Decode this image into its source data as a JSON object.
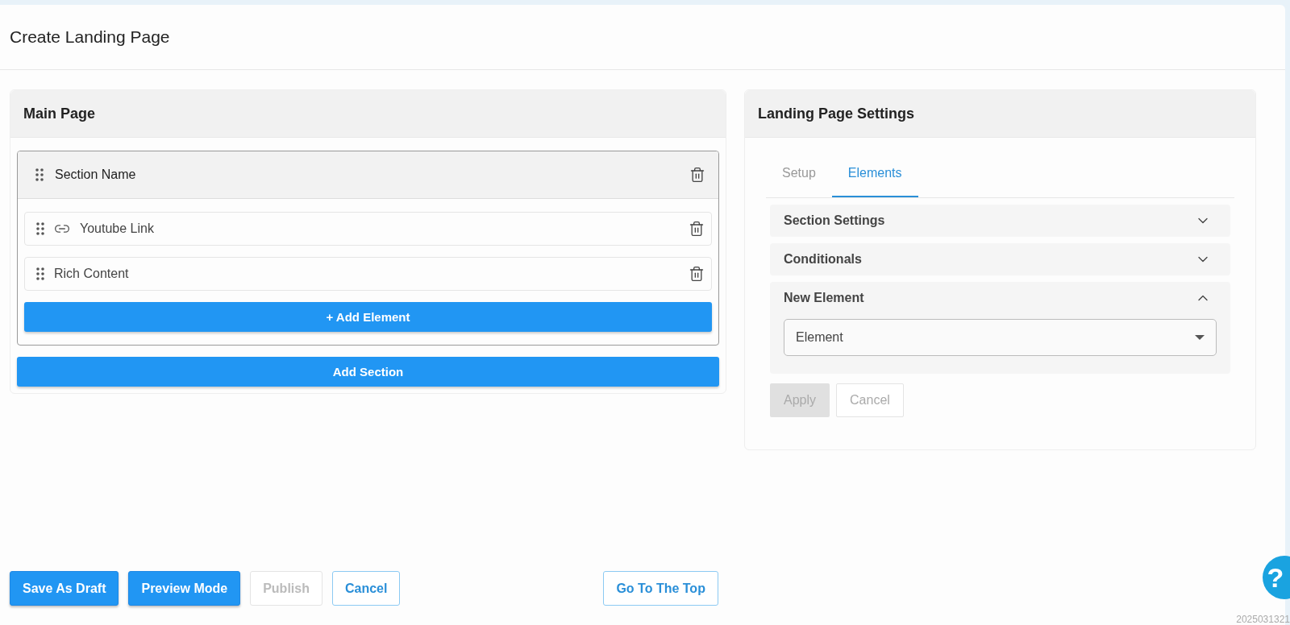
{
  "page": {
    "title": "Create Landing Page"
  },
  "main_panel": {
    "title": "Main Page",
    "section": {
      "name": "Section Name",
      "elements": [
        {
          "label": "Youtube Link",
          "kind": "link"
        },
        {
          "label": "Rich Content",
          "kind": "plain"
        }
      ],
      "add_element_button": "+ Add Element"
    },
    "add_section_button": "Add Section"
  },
  "settings_panel": {
    "title": "Landing Page Settings",
    "tabs": [
      {
        "label": "Setup",
        "selected": false
      },
      {
        "label": "Elements",
        "selected": true
      }
    ],
    "accordions": [
      {
        "title": "Section Settings",
        "expanded": false
      },
      {
        "title": "Conditionals",
        "expanded": false
      },
      {
        "title": "New Element",
        "expanded": true,
        "select_value": "Element"
      }
    ],
    "buttons": [
      {
        "label": "Apply",
        "disabled": true,
        "kind": "filled"
      },
      {
        "label": "Cancel",
        "disabled": true,
        "kind": "outline"
      }
    ]
  },
  "footer_buttons": [
    {
      "label": "Save As Draft",
      "kind": "primary",
      "disabled": false
    },
    {
      "label": "Preview Mode",
      "kind": "primary",
      "disabled": false
    },
    {
      "label": "Publish",
      "kind": "outline",
      "disabled": true
    },
    {
      "label": "Cancel",
      "kind": "outline",
      "disabled": false
    }
  ],
  "top_button": "Go To The Top",
  "help_button": "?",
  "version": "2025031321"
}
